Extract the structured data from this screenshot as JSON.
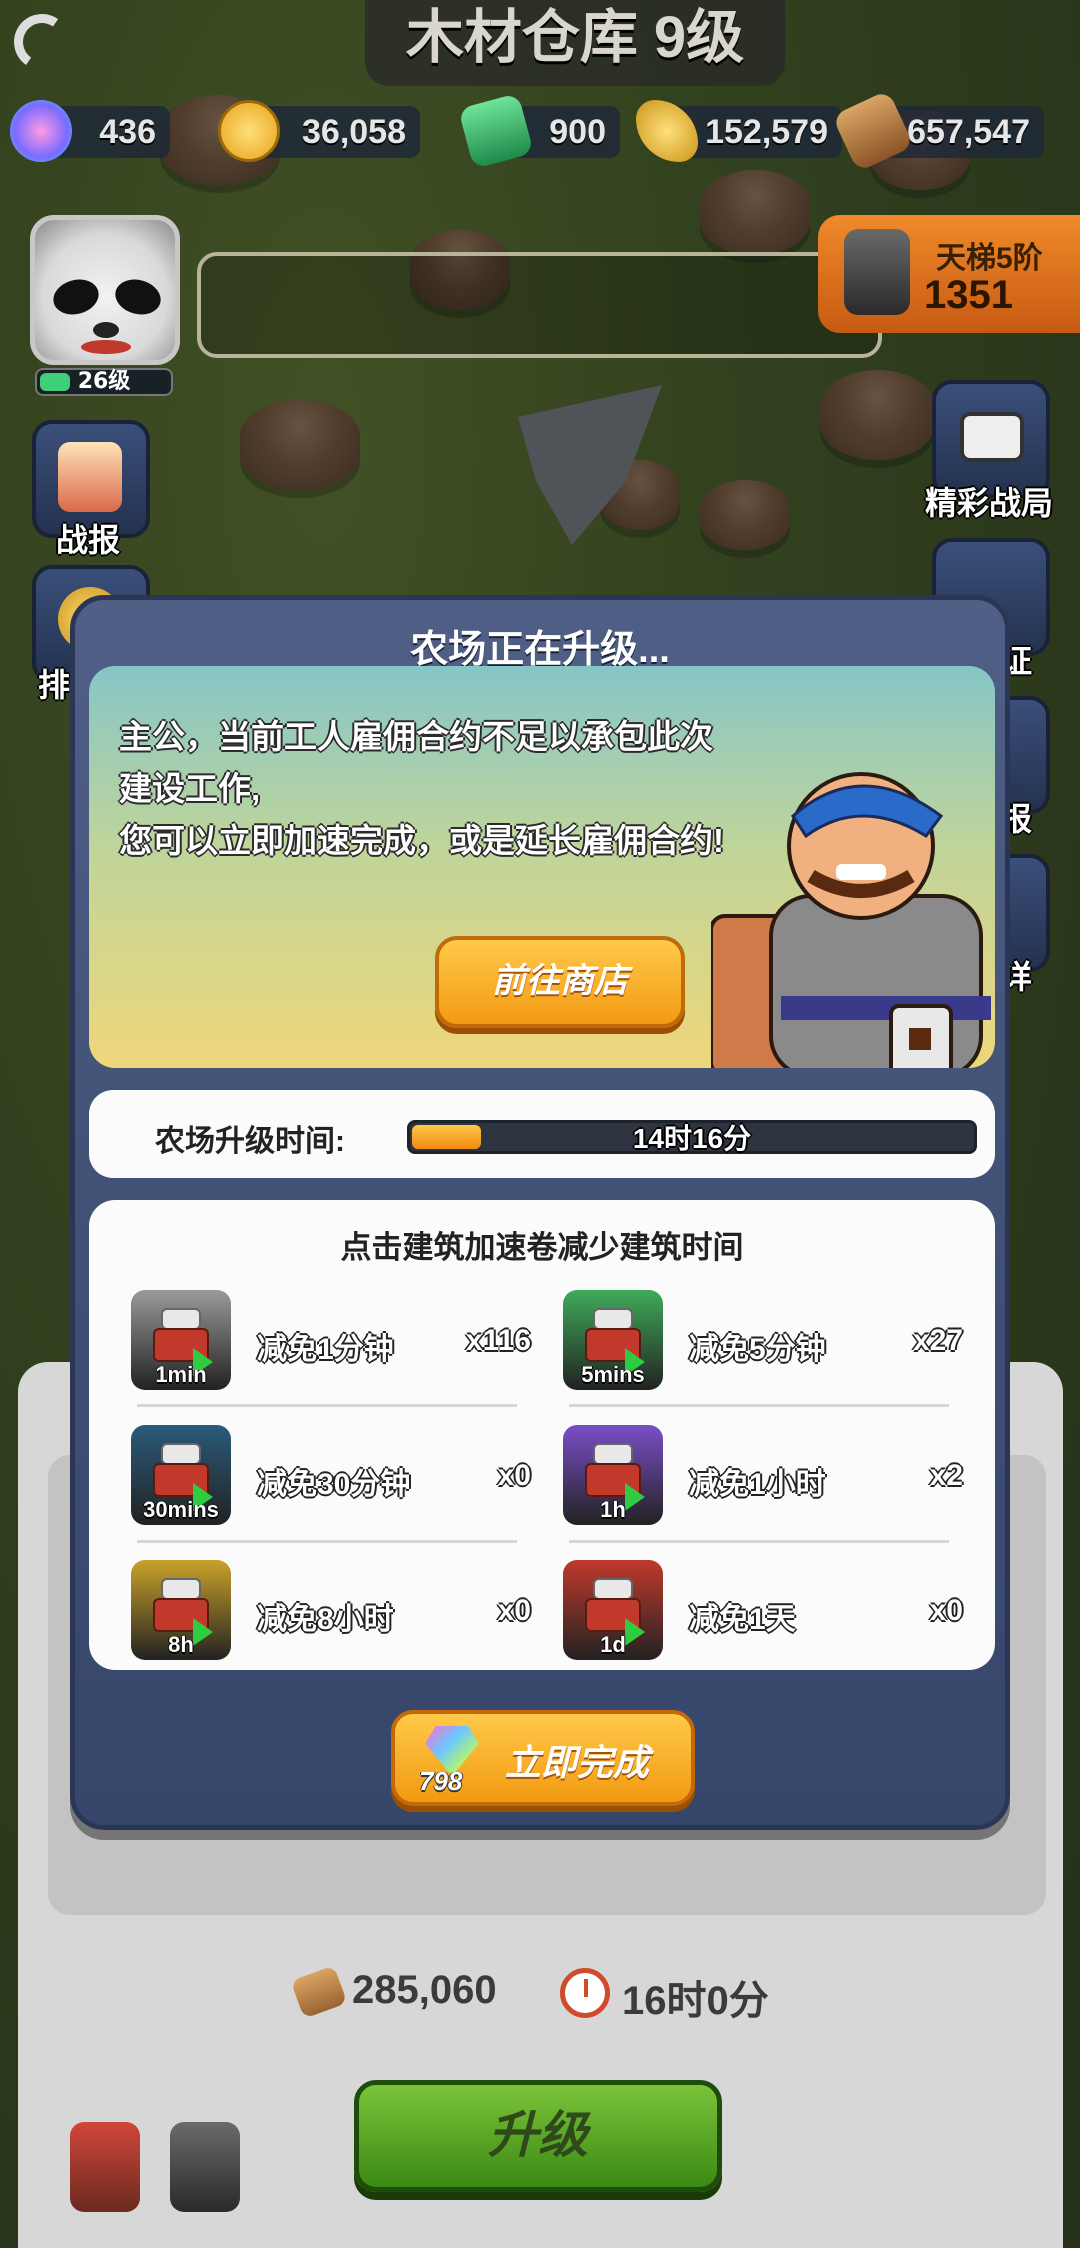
{
  "header": {
    "title": "木材仓库 9级"
  },
  "resources": [
    {
      "name": "gems",
      "value": "436",
      "color": "#c96bd6"
    },
    {
      "name": "coins",
      "value": "36,058",
      "color": "#e8b32a"
    },
    {
      "name": "jade",
      "value": "900",
      "color": "#3fb86b"
    },
    {
      "name": "grain",
      "value": "152,579",
      "color": "#e8b12e"
    },
    {
      "name": "wood",
      "value": "657,547",
      "color": "#b8773a"
    }
  ],
  "player": {
    "level": "26级"
  },
  "ladder": {
    "rank_label": "天梯5阶",
    "score": "1351"
  },
  "side_buttons": {
    "battle_report": "战报",
    "rank": "排",
    "highlights": "精彩战局",
    "right_2": "证",
    "right_3": "报",
    "right_4": "详"
  },
  "dialog": {
    "title": "农场正在升级...",
    "message_line1": "主公，当前工人雇佣合约不足以承包此次建设工作,",
    "message_line2": "您可以立即加速完成，或是延长雇佣合约!",
    "shop_button": "前往商店",
    "timer_label": "农场升级时间:",
    "timer_value": "14时16分",
    "timer_progress_percent": 13,
    "items_title": "点击建筑加速卷减少建筑时间",
    "items": [
      {
        "duration": "1min",
        "name": "减免1分钟",
        "qty": "x116",
        "color": "#9a9a9a"
      },
      {
        "duration": "5mins",
        "name": "减免5分钟",
        "qty": "x27",
        "color": "#3faa5a"
      },
      {
        "duration": "30mins",
        "name": "减免30分钟",
        "qty": "x0",
        "color": "#2a5a7a"
      },
      {
        "duration": "1h",
        "name": "减免1小时",
        "qty": "x2",
        "color": "#7a4ec8"
      },
      {
        "duration": "8h",
        "name": "减免8小时",
        "qty": "x0",
        "color": "#c9a12a"
      },
      {
        "duration": "1d",
        "name": "减免1天",
        "qty": "x0",
        "color": "#c0392b"
      }
    ],
    "finish_cost": "798",
    "finish_button": "立即完成"
  },
  "upgrade_panel": {
    "wood_cost": "285,060",
    "time_cost": "16时0分",
    "upgrade_button": "升级"
  }
}
